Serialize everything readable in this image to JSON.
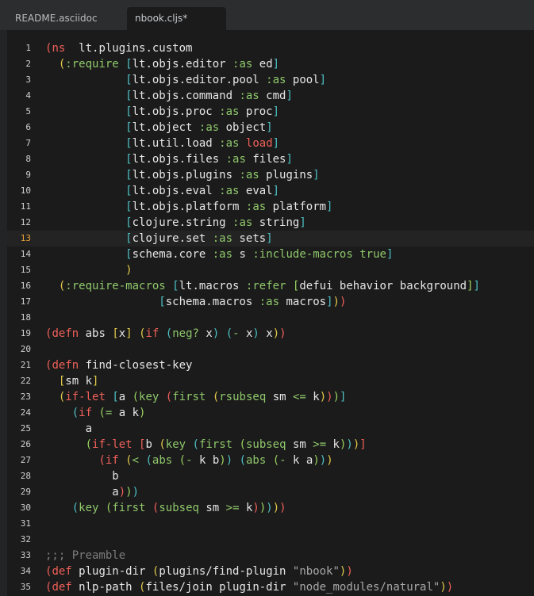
{
  "tabs": [
    {
      "label": "README.asciidoc",
      "active": false
    },
    {
      "label": "nbook.cljs*",
      "active": true
    }
  ],
  "editor": {
    "cursor_line": 13,
    "lines": [
      {
        "n": "1",
        "t": [
          [
            "b1",
            "("
          ],
          [
            "kw",
            "ns"
          ],
          [
            "",
            "  lt.plugins.custom"
          ]
        ]
      },
      {
        "n": "2",
        "t": [
          [
            "",
            "  "
          ],
          [
            "b2",
            "("
          ],
          [
            "kwd",
            ":require"
          ],
          [
            "",
            " "
          ],
          [
            "b3",
            "["
          ],
          [
            "",
            "lt.objs.editor "
          ],
          [
            "kwd",
            ":as"
          ],
          [
            "",
            " ed"
          ],
          [
            "b3",
            "]"
          ]
        ]
      },
      {
        "n": "3",
        "t": [
          [
            "",
            "            "
          ],
          [
            "b3",
            "["
          ],
          [
            "",
            "lt.objs.editor.pool "
          ],
          [
            "kwd",
            ":as"
          ],
          [
            "",
            " pool"
          ],
          [
            "b3",
            "]"
          ]
        ]
      },
      {
        "n": "4",
        "t": [
          [
            "",
            "            "
          ],
          [
            "b3",
            "["
          ],
          [
            "",
            "lt.objs.command "
          ],
          [
            "kwd",
            ":as"
          ],
          [
            "",
            " cmd"
          ],
          [
            "b3",
            "]"
          ]
        ]
      },
      {
        "n": "5",
        "t": [
          [
            "",
            "            "
          ],
          [
            "b3",
            "["
          ],
          [
            "",
            "lt.objs.proc "
          ],
          [
            "kwd",
            ":as"
          ],
          [
            "",
            " proc"
          ],
          [
            "b3",
            "]"
          ]
        ]
      },
      {
        "n": "6",
        "t": [
          [
            "",
            "            "
          ],
          [
            "b3",
            "["
          ],
          [
            "",
            "lt.object "
          ],
          [
            "kwd",
            ":as"
          ],
          [
            "",
            " object"
          ],
          [
            "b3",
            "]"
          ]
        ]
      },
      {
        "n": "7",
        "t": [
          [
            "",
            "            "
          ],
          [
            "b3",
            "["
          ],
          [
            "",
            "lt.util.load "
          ],
          [
            "kwd",
            ":as"
          ],
          [
            "",
            " "
          ],
          [
            "kw",
            "load"
          ],
          [
            "b3",
            "]"
          ]
        ]
      },
      {
        "n": "8",
        "t": [
          [
            "",
            "            "
          ],
          [
            "b3",
            "["
          ],
          [
            "",
            "lt.objs.files "
          ],
          [
            "kwd",
            ":as"
          ],
          [
            "",
            " files"
          ],
          [
            "b3",
            "]"
          ]
        ]
      },
      {
        "n": "9",
        "t": [
          [
            "",
            "            "
          ],
          [
            "b3",
            "["
          ],
          [
            "",
            "lt.objs.plugins "
          ],
          [
            "kwd",
            ":as"
          ],
          [
            "",
            " plugins"
          ],
          [
            "b3",
            "]"
          ]
        ]
      },
      {
        "n": "10",
        "t": [
          [
            "",
            "            "
          ],
          [
            "b3",
            "["
          ],
          [
            "",
            "lt.objs.eval "
          ],
          [
            "kwd",
            ":as"
          ],
          [
            "",
            " eval"
          ],
          [
            "b3",
            "]"
          ]
        ]
      },
      {
        "n": "11",
        "t": [
          [
            "",
            "            "
          ],
          [
            "b3",
            "["
          ],
          [
            "",
            "lt.objs.platform "
          ],
          [
            "kwd",
            ":as"
          ],
          [
            "",
            " platform"
          ],
          [
            "b3",
            "]"
          ]
        ]
      },
      {
        "n": "12",
        "t": [
          [
            "",
            "            "
          ],
          [
            "b3",
            "["
          ],
          [
            "",
            "clojure.string "
          ],
          [
            "kwd",
            ":as"
          ],
          [
            "",
            " string"
          ],
          [
            "b3",
            "]"
          ]
        ]
      },
      {
        "n": "13",
        "t": [
          [
            "",
            "            "
          ],
          [
            "b3",
            "["
          ],
          [
            "",
            "clojure.set "
          ],
          [
            "kwd",
            ":as"
          ],
          [
            "",
            " sets"
          ],
          [
            "b3",
            "]"
          ]
        ]
      },
      {
        "n": "14",
        "t": [
          [
            "",
            "            "
          ],
          [
            "b3",
            "["
          ],
          [
            "",
            "schema.core "
          ],
          [
            "kwd",
            ":as"
          ],
          [
            "",
            " s "
          ],
          [
            "kwd",
            ":include-macros"
          ],
          [
            "",
            " "
          ],
          [
            "kwd",
            "true"
          ],
          [
            "b3",
            "]"
          ]
        ]
      },
      {
        "n": "15",
        "t": [
          [
            "",
            "            "
          ],
          [
            "b2",
            ")"
          ]
        ]
      },
      {
        "n": "16",
        "t": [
          [
            "",
            "  "
          ],
          [
            "b2",
            "("
          ],
          [
            "kwd",
            ":require-macros"
          ],
          [
            "",
            " "
          ],
          [
            "b3",
            "["
          ],
          [
            "",
            "lt.macros "
          ],
          [
            "kwd",
            ":refer"
          ],
          [
            "",
            " "
          ],
          [
            "b4",
            "["
          ],
          [
            "",
            "defui behavior background"
          ],
          [
            "b4",
            "]"
          ],
          [
            "b3",
            "]"
          ]
        ]
      },
      {
        "n": "17",
        "t": [
          [
            "",
            "                 "
          ],
          [
            "b3",
            "["
          ],
          [
            "",
            "schema.macros "
          ],
          [
            "kwd",
            ":as"
          ],
          [
            "",
            " macros"
          ],
          [
            "b3",
            "]"
          ],
          [
            "b2",
            ")"
          ],
          [
            "b1",
            ")"
          ]
        ]
      },
      {
        "n": "18",
        "t": []
      },
      {
        "n": "19",
        "t": [
          [
            "b1",
            "("
          ],
          [
            "kw",
            "defn"
          ],
          [
            "",
            " abs "
          ],
          [
            "b2",
            "["
          ],
          [
            "",
            "x"
          ],
          [
            "b2",
            "]"
          ],
          [
            "",
            " "
          ],
          [
            "b2",
            "("
          ],
          [
            "kw",
            "if"
          ],
          [
            "",
            " "
          ],
          [
            "b3",
            "("
          ],
          [
            "kwd",
            "neg?"
          ],
          [
            "",
            " x"
          ],
          [
            "b3",
            ")"
          ],
          [
            "",
            " "
          ],
          [
            "b3",
            "("
          ],
          [
            "kwd",
            "-"
          ],
          [
            "",
            " x"
          ],
          [
            "b3",
            ")"
          ],
          [
            "",
            " x"
          ],
          [
            "b2",
            ")"
          ],
          [
            "b1",
            ")"
          ]
        ]
      },
      {
        "n": "20",
        "t": []
      },
      {
        "n": "21",
        "t": [
          [
            "b1",
            "("
          ],
          [
            "kw",
            "defn"
          ],
          [
            "",
            " find-closest-key"
          ]
        ]
      },
      {
        "n": "22",
        "t": [
          [
            "",
            "  "
          ],
          [
            "b2",
            "["
          ],
          [
            "",
            "sm k"
          ],
          [
            "b2",
            "]"
          ]
        ]
      },
      {
        "n": "23",
        "t": [
          [
            "",
            "  "
          ],
          [
            "b2",
            "("
          ],
          [
            "kw",
            "if-let"
          ],
          [
            "",
            " "
          ],
          [
            "b3",
            "["
          ],
          [
            "",
            "a "
          ],
          [
            "b4",
            "("
          ],
          [
            "kwd",
            "key"
          ],
          [
            "",
            " "
          ],
          [
            "b1",
            "("
          ],
          [
            "kwd",
            "first"
          ],
          [
            "",
            " "
          ],
          [
            "b2",
            "("
          ],
          [
            "kwd",
            "rsubseq"
          ],
          [
            "",
            " sm "
          ],
          [
            "kwd",
            "<="
          ],
          [
            "",
            " k"
          ],
          [
            "b2",
            ")"
          ],
          [
            "b1",
            ")"
          ],
          [
            "b4",
            ")"
          ],
          [
            "b3",
            "]"
          ]
        ]
      },
      {
        "n": "24",
        "t": [
          [
            "",
            "    "
          ],
          [
            "b3",
            "("
          ],
          [
            "kw",
            "if"
          ],
          [
            "",
            " "
          ],
          [
            "b4",
            "("
          ],
          [
            "kwd",
            "="
          ],
          [
            "",
            " a k"
          ],
          [
            "b4",
            ")"
          ]
        ]
      },
      {
        "n": "25",
        "t": [
          [
            "",
            "      a"
          ]
        ]
      },
      {
        "n": "26",
        "t": [
          [
            "",
            "      "
          ],
          [
            "b4",
            "("
          ],
          [
            "kw",
            "if-let"
          ],
          [
            "",
            " "
          ],
          [
            "b1",
            "["
          ],
          [
            "",
            "b "
          ],
          [
            "b2",
            "("
          ],
          [
            "kwd",
            "key"
          ],
          [
            "",
            " "
          ],
          [
            "b3",
            "("
          ],
          [
            "kwd",
            "first"
          ],
          [
            "",
            " "
          ],
          [
            "b4",
            "("
          ],
          [
            "kwd",
            "subseq"
          ],
          [
            "",
            " sm "
          ],
          [
            "kwd",
            ">="
          ],
          [
            "",
            " k"
          ],
          [
            "b4",
            ")"
          ],
          [
            "b3",
            ")"
          ],
          [
            "b2",
            ")"
          ],
          [
            "b1",
            "]"
          ]
        ]
      },
      {
        "n": "27",
        "t": [
          [
            "",
            "        "
          ],
          [
            "b1",
            "("
          ],
          [
            "kw",
            "if"
          ],
          [
            "",
            " "
          ],
          [
            "b2",
            "("
          ],
          [
            "kwd",
            "<"
          ],
          [
            "",
            " "
          ],
          [
            "b3",
            "("
          ],
          [
            "kwd",
            "abs"
          ],
          [
            "",
            " "
          ],
          [
            "b4",
            "("
          ],
          [
            "kwd",
            "-"
          ],
          [
            "",
            " k b"
          ],
          [
            "b4",
            ")"
          ],
          [
            "b3",
            ")"
          ],
          [
            "",
            " "
          ],
          [
            "b3",
            "("
          ],
          [
            "kwd",
            "abs"
          ],
          [
            "",
            " "
          ],
          [
            "b4",
            "("
          ],
          [
            "kwd",
            "-"
          ],
          [
            "",
            " k a"
          ],
          [
            "b4",
            ")"
          ],
          [
            "b3",
            ")"
          ],
          [
            "b2",
            ")"
          ]
        ]
      },
      {
        "n": "28",
        "t": [
          [
            "",
            "          b"
          ]
        ]
      },
      {
        "n": "29",
        "t": [
          [
            "",
            "          a"
          ],
          [
            "b1",
            ")"
          ],
          [
            "b4",
            ")"
          ],
          [
            "b3",
            ")"
          ]
        ]
      },
      {
        "n": "30",
        "t": [
          [
            "",
            "    "
          ],
          [
            "b3",
            "("
          ],
          [
            "kwd",
            "key"
          ],
          [
            "",
            " "
          ],
          [
            "b4",
            "("
          ],
          [
            "kwd",
            "first"
          ],
          [
            "",
            " "
          ],
          [
            "b1",
            "("
          ],
          [
            "kwd",
            "subseq"
          ],
          [
            "",
            " sm "
          ],
          [
            "kwd",
            ">="
          ],
          [
            "",
            " k"
          ],
          [
            "b1",
            ")"
          ],
          [
            "b4",
            ")"
          ],
          [
            "b3",
            ")"
          ],
          [
            "b2",
            ")"
          ],
          [
            "b1",
            ")"
          ]
        ]
      },
      {
        "n": "31",
        "t": []
      },
      {
        "n": "32",
        "t": []
      },
      {
        "n": "33",
        "t": [
          [
            "cmt",
            ";;; Preamble"
          ]
        ]
      },
      {
        "n": "34",
        "t": [
          [
            "b1",
            "("
          ],
          [
            "kw",
            "def"
          ],
          [
            "",
            " plugin-dir "
          ],
          [
            "b2",
            "("
          ],
          [
            "",
            "plugins/find-plugin "
          ],
          [
            "str",
            "\"nbook\""
          ],
          [
            "b2",
            ")"
          ],
          [
            "b1",
            ")"
          ]
        ]
      },
      {
        "n": "35",
        "t": [
          [
            "b1",
            "("
          ],
          [
            "kw",
            "def"
          ],
          [
            "",
            " nlp-path "
          ],
          [
            "b2",
            "("
          ],
          [
            "",
            "files/join plugin-dir "
          ],
          [
            "str",
            "\"node_modules/natural\""
          ],
          [
            "b2",
            ")"
          ],
          [
            "b1",
            ")"
          ]
        ]
      }
    ]
  }
}
